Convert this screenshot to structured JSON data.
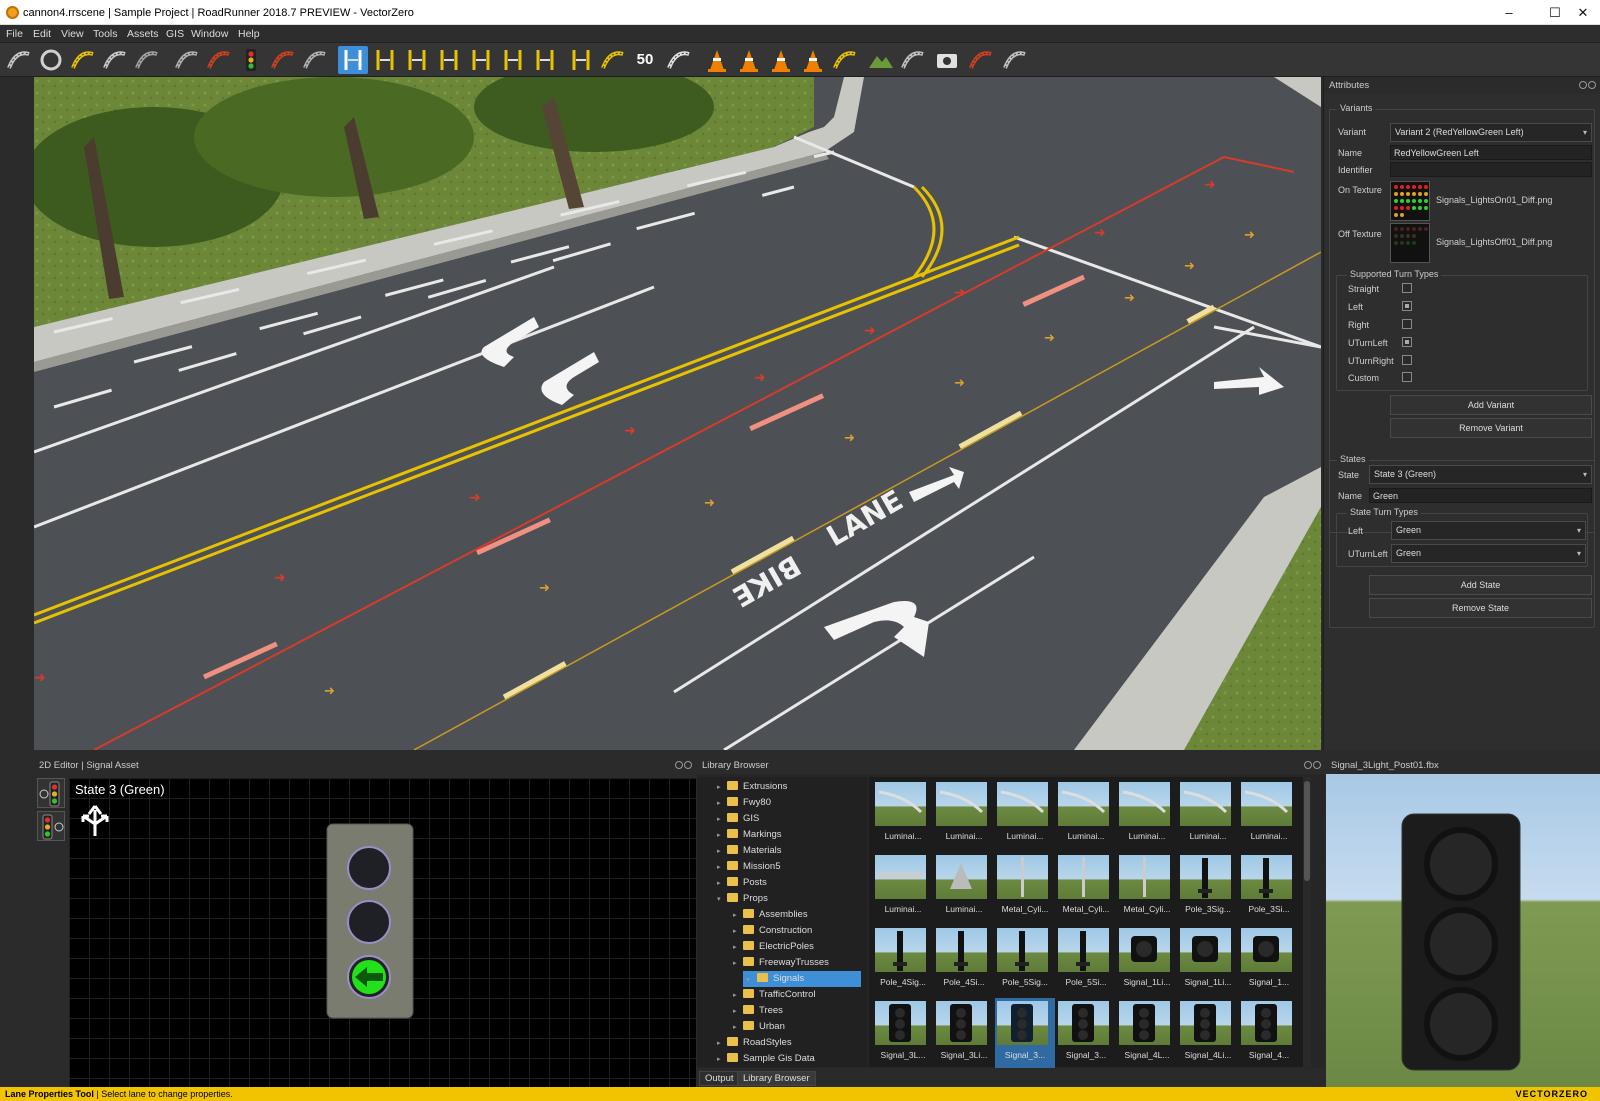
{
  "window": {
    "title": "cannon4.rrscene | Sample Project | RoadRunner 2018.7 PREVIEW - VectorZero"
  },
  "menu": [
    "File",
    "Edit",
    "View",
    "Tools",
    "Assets",
    "GIS",
    "Window",
    "Help"
  ],
  "toolbar": {
    "icons": [
      "road-plan-icon",
      "circle-road-icon",
      "road-construction-icon",
      "elevation-icon",
      "bridge-icon",
      "junction-icon",
      "roundabout-icon",
      "signal-icon",
      "maneuver-icon",
      "lane-icon",
      "lane-properties-icon",
      "lane-width-icon",
      "lane-add-icon",
      "lane-form-icon",
      "lane-carve-icon",
      "lane-marking-icon",
      "lane-split-icon",
      "lane-center-icon",
      "curve-icon",
      "speed-limit-icon",
      "crosswalk-icon",
      "cone-icon",
      "cone-group-icon",
      "cone-spline-icon",
      "cone-line-icon",
      "sign-icon",
      "terrain-icon",
      "measure-icon",
      "snapshot-icon",
      "scenario-icon",
      "visibility-icon"
    ],
    "speed_label": "50"
  },
  "viewport": {
    "markings": [
      "LANE",
      "BIKE"
    ]
  },
  "attributes": {
    "title": "Attributes",
    "variants_group": "Variants",
    "variant_label": "Variant",
    "variant_value": "Variant 2 (RedYellowGreen Left)",
    "name_label": "Name",
    "name_value": "RedYellowGreen Left",
    "identifier_label": "Identifier",
    "identifier_value": "",
    "on_texture_label": "On Texture",
    "on_texture_file": "Signals_LightsOn01_Diff.png",
    "off_texture_label": "Off Texture",
    "off_texture_file": "Signals_LightsOff01_Diff.png",
    "turn_types_group": "Supported Turn Types",
    "turn_types": [
      {
        "label": "Straight",
        "checked": false
      },
      {
        "label": "Left",
        "checked": true
      },
      {
        "label": "Right",
        "checked": false
      },
      {
        "label": "UTurnLeft",
        "checked": true
      },
      {
        "label": "UTurnRight",
        "checked": false
      },
      {
        "label": "Custom",
        "checked": false
      }
    ],
    "add_variant": "Add Variant",
    "remove_variant": "Remove Variant",
    "states_group": "States",
    "state_label": "State",
    "state_value": "State 3 (Green)",
    "state_name_label": "Name",
    "state_name_value": "Green",
    "state_turn_types_group": "State Turn Types",
    "state_left_label": "Left",
    "state_left_value": "Green",
    "state_uturn_label": "UTurnLeft",
    "state_uturn_value": "Green",
    "add_state": "Add State",
    "remove_state": "Remove State"
  },
  "editor2d": {
    "title": "2D Editor | Signal Asset",
    "state_caption": "State 3 (Green)"
  },
  "library": {
    "title": "Library Browser",
    "tree": [
      {
        "label": "Extrusions",
        "indent": 0,
        "expanded": false
      },
      {
        "label": "Fwy80",
        "indent": 0,
        "expanded": false
      },
      {
        "label": "GIS",
        "indent": 0,
        "expanded": false
      },
      {
        "label": "Markings",
        "indent": 0,
        "expanded": false
      },
      {
        "label": "Materials",
        "indent": 0,
        "expanded": false
      },
      {
        "label": "Mission5",
        "indent": 0,
        "expanded": false
      },
      {
        "label": "Posts",
        "indent": 0,
        "expanded": false
      },
      {
        "label": "Props",
        "indent": 0,
        "expanded": true
      },
      {
        "label": "Assemblies",
        "indent": 1,
        "expanded": false
      },
      {
        "label": "Construction",
        "indent": 1,
        "expanded": false
      },
      {
        "label": "ElectricPoles",
        "indent": 1,
        "expanded": false
      },
      {
        "label": "FreewayTrusses",
        "indent": 1,
        "expanded": false
      },
      {
        "label": "Signals",
        "indent": 1,
        "expanded": false,
        "selected": true
      },
      {
        "label": "TrafficControl",
        "indent": 1,
        "expanded": false
      },
      {
        "label": "Trees",
        "indent": 1,
        "expanded": false
      },
      {
        "label": "Urban",
        "indent": 1,
        "expanded": false
      },
      {
        "label": "RoadStyles",
        "indent": 0,
        "expanded": false
      },
      {
        "label": "Sample Gis Data",
        "indent": 0,
        "expanded": false
      }
    ],
    "thumbnails": [
      [
        "Luminai...",
        "Luminai...",
        "Luminai...",
        "Luminai...",
        "Luminai...",
        "Luminai...",
        "Luminai..."
      ],
      [
        "Luminai...",
        "Luminai...",
        "Metal_Cyli...",
        "Metal_Cyli...",
        "Metal_Cyli...",
        "Pole_3Sig...",
        "Pole_3Si..."
      ],
      [
        "Pole_4Sig...",
        "Pole_4Si...",
        "Pole_5Sig...",
        "Pole_5Si...",
        "Signal_1Li...",
        "Signal_1Li...",
        "Signal_1..."
      ],
      [
        "Signal_3L...",
        "Signal_3Li...",
        "Signal_3...",
        "Signal_3...",
        "Signal_4L...",
        "Signal_4Li...",
        "Signal_4..."
      ]
    ],
    "selected_thumbnail": "Signal_3...",
    "tab_output": "Output",
    "tab_library": "Library Browser"
  },
  "preview": {
    "title": "Signal_3Light_Post01.fbx"
  },
  "status": {
    "tool": "Lane Properties Tool",
    "message": "Select lane to change properties.",
    "brand": "VECTORZERO"
  },
  "colors": {
    "accent": "#3d8fd9",
    "status": "#f2c400",
    "green_light": "#22e01a"
  }
}
